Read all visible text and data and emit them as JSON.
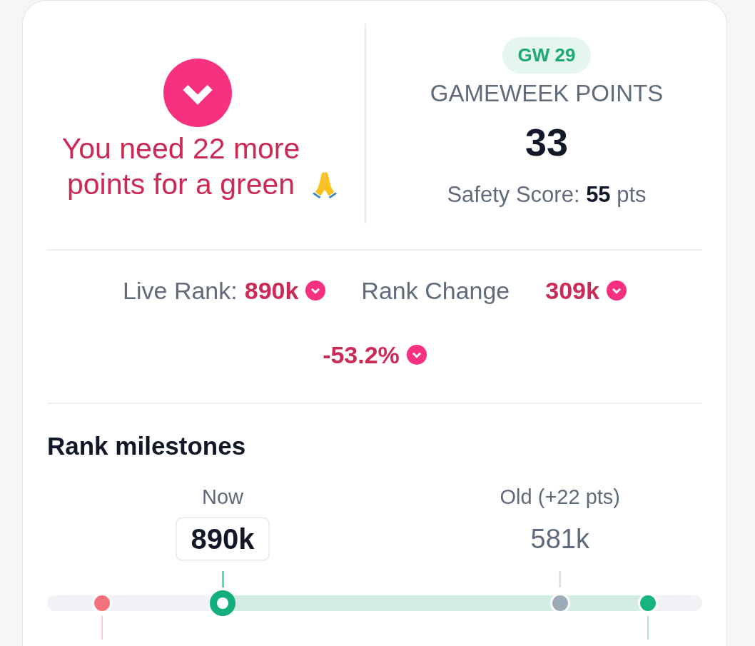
{
  "alert": {
    "down": true,
    "message": "You need 22 more points for a green"
  },
  "gameweek": {
    "badge": "GW 29",
    "label": "GAMEWEEK POINTS",
    "points": "33",
    "safety_score": "Safety Score: **55** pts"
  },
  "rank_stats": [
    {
      "label": "Live Rank:",
      "value": "890k",
      "down": true
    },
    {
      "label": "Rank Change"
    },
    {
      "value": "309k",
      "down": true
    },
    {
      "value": "-53.2%",
      "down": true
    }
  ],
  "milestones": {
    "title": "Rank milestones",
    "markers": [
      {
        "kind": "dot",
        "color": "#f4717f"
      },
      {
        "kind": "current",
        "color": "#14ad7d",
        "label": "Now",
        "value": "890k"
      },
      {
        "kind": "dot",
        "color": "#9eacb9",
        "label": "Old (+22 pts)",
        "value": "581k"
      },
      {
        "kind": "dot",
        "color": "#16b47f"
      }
    ]
  }
}
